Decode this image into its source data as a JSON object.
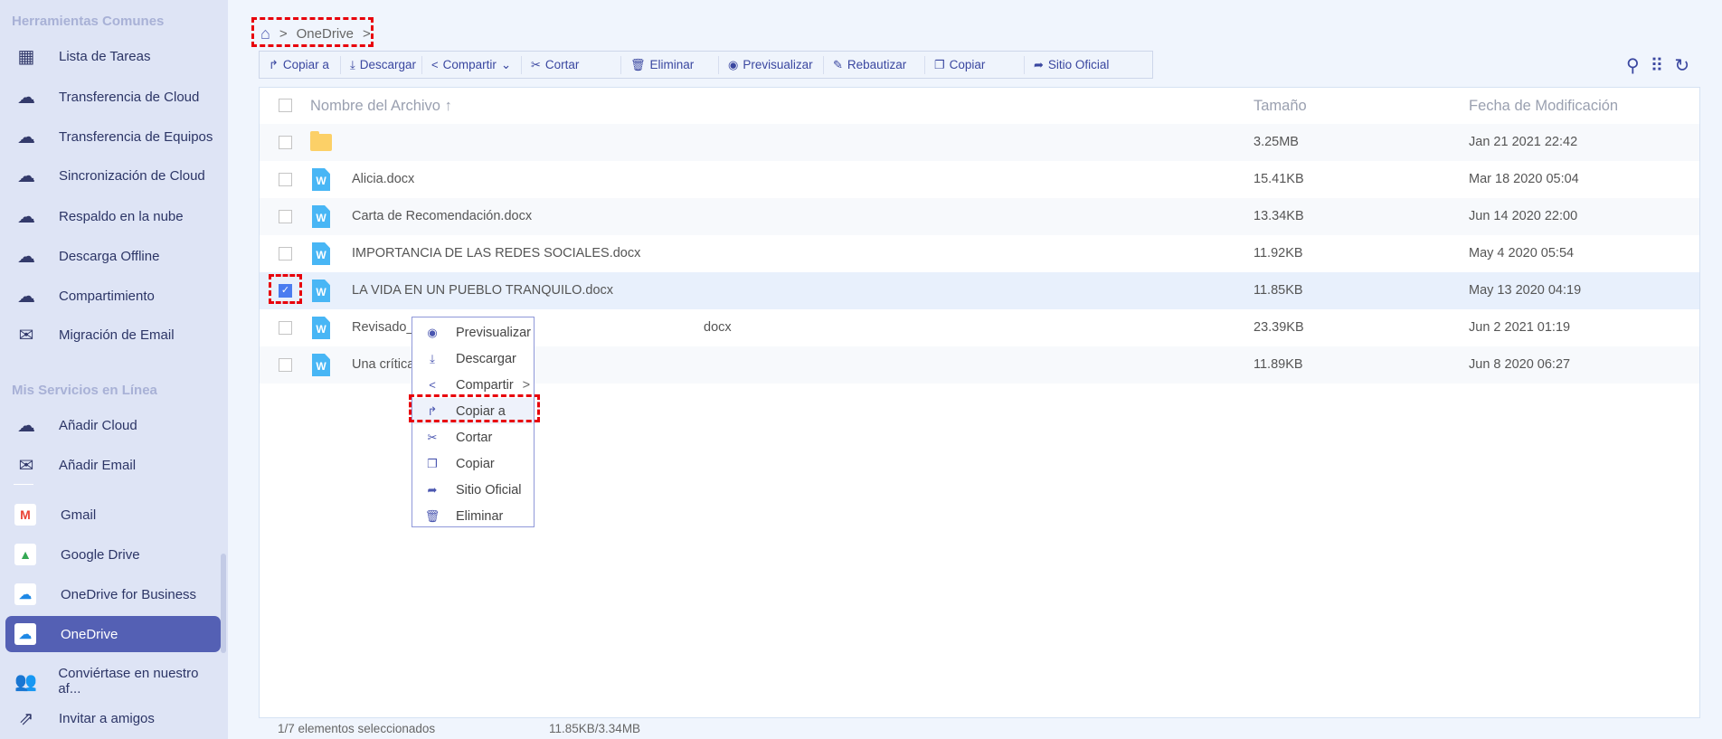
{
  "sidebar": {
    "section1": "Herramientas Comunes",
    "tools": [
      {
        "label": "Lista de Tareas",
        "icon": "grid-icon",
        "glyph": "▦"
      },
      {
        "label": "Transferencia de Cloud",
        "icon": "cloud-transfer-icon",
        "glyph": "☁"
      },
      {
        "label": "Transferencia de Equipos",
        "icon": "team-transfer-icon",
        "glyph": "☁"
      },
      {
        "label": "Sincronización de Cloud",
        "icon": "cloud-sync-icon",
        "glyph": "☁"
      },
      {
        "label": "Respaldo en la nube",
        "icon": "cloud-backup-icon",
        "glyph": "☁"
      },
      {
        "label": "Descarga Offline",
        "icon": "cloud-download-icon",
        "glyph": "☁"
      },
      {
        "label": "Compartimiento",
        "icon": "share-cloud-icon",
        "glyph": "☁"
      },
      {
        "label": "Migración de Email",
        "icon": "email-migration-icon",
        "glyph": "✉"
      }
    ],
    "section2": "Mis Servicios en Línea",
    "services": [
      {
        "label": "Añadir Cloud",
        "icon": "add-cloud-icon",
        "glyph": "☁"
      },
      {
        "label": "Añadir Email",
        "icon": "add-email-icon",
        "glyph": "✉"
      }
    ],
    "accounts": [
      {
        "label": "Gmail",
        "icon": "gmail-icon",
        "glyph": "M",
        "color": "#ea4335"
      },
      {
        "label": "Google Drive",
        "icon": "google-drive-icon",
        "glyph": "▲",
        "color": "#34a853"
      },
      {
        "label": "OneDrive for Business",
        "icon": "onedrive-business-icon",
        "glyph": "☁",
        "color": "#1e88e5"
      },
      {
        "label": "OneDrive",
        "icon": "onedrive-icon",
        "glyph": "☁",
        "color": "#1e88e5",
        "active": true
      }
    ],
    "bottom": [
      {
        "label": "Conviértase en nuestro af...",
        "icon": "affiliate-users-icon",
        "glyph": "👥"
      },
      {
        "label": "Invitar a amigos",
        "icon": "invite-share-icon",
        "glyph": "⇗"
      }
    ]
  },
  "breadcrumb": {
    "current": "OneDrive",
    "sep": ">"
  },
  "toolbar": [
    {
      "label": "Copiar a",
      "icon": "copy-to-icon",
      "glyph": "↱",
      "w": 90
    },
    {
      "label": "Descargar",
      "icon": "download-icon",
      "glyph": "⤓",
      "w": 90
    },
    {
      "label": "Compartir",
      "icon": "share-icon",
      "glyph": "<",
      "w": 110,
      "caret": "⌄"
    },
    {
      "label": "Cortar",
      "icon": "scissors-icon",
      "glyph": "✂",
      "w": 110
    },
    {
      "label": "Eliminar",
      "icon": "trash-icon",
      "glyph": "🗑",
      "w": 108
    },
    {
      "label": "Previsualizar",
      "icon": "eye-icon",
      "glyph": "◉",
      "w": 116
    },
    {
      "label": "Rebautizar",
      "icon": "pencil-icon",
      "glyph": "✎",
      "w": 112
    },
    {
      "label": "Copiar",
      "icon": "copy-icon",
      "glyph": "❐",
      "w": 110
    },
    {
      "label": "Sitio Oficial",
      "icon": "external-share-icon",
      "glyph": "➦",
      "w": 110
    }
  ],
  "table": {
    "headers": {
      "name": "Nombre del Archivo",
      "sort": "↑",
      "size": "Tamaño",
      "date": "Fecha de Modificación"
    },
    "rows": [
      {
        "name": "",
        "type": "folder",
        "size": "3.25MB",
        "date": "Jan 21 2021 22:42"
      },
      {
        "name": "Alicia.docx",
        "type": "docx",
        "size": "15.41KB",
        "date": "Mar 18 2020 05:04"
      },
      {
        "name": "Carta de Recomendación.docx",
        "type": "docx",
        "size": "13.34KB",
        "date": "Jun 14 2020 22:00"
      },
      {
        "name": "IMPORTANCIA DE LAS REDES SOCIALES.docx",
        "type": "docx",
        "size": "11.92KB",
        "date": "May 4 2020 05:54"
      },
      {
        "name": "LA VIDA EN UN PUEBLO TRANQUILO.docx",
        "type": "docx",
        "size": "11.85KB",
        "date": "May 13 2020 04:19",
        "selected": true
      },
      {
        "name": "Revisado_",
        "name_tail": "docx",
        "type": "docx",
        "size": "23.39KB",
        "date": "Jun 2 2021 01:19"
      },
      {
        "name": "Una crítica",
        "type": "docx",
        "size": "11.89KB",
        "date": "Jun 8 2020 06:27"
      }
    ]
  },
  "context_menu": [
    {
      "label": "Previsualizar",
      "icon": "eye-icon",
      "glyph": "◉"
    },
    {
      "label": "Descargar",
      "icon": "download-icon",
      "glyph": "⤓"
    },
    {
      "label": "Compartir",
      "icon": "share-icon",
      "glyph": "<",
      "submenu": ">"
    },
    {
      "label": "Copiar a",
      "icon": "copy-to-icon",
      "glyph": "↱",
      "highlighted": true
    },
    {
      "label": "Cortar",
      "icon": "scissors-icon",
      "glyph": "✂"
    },
    {
      "label": "Copiar",
      "icon": "copy-icon",
      "glyph": "❐"
    },
    {
      "label": "Sitio Oficial",
      "icon": "external-share-icon",
      "glyph": "➦"
    },
    {
      "label": "Eliminar",
      "icon": "trash-icon",
      "glyph": "🗑"
    }
  ],
  "footer": {
    "selection": "1/7 elementos seleccionados",
    "size": "11.85KB/3.34MB"
  },
  "colors": {
    "accent": "#5460b4",
    "highlight": "#e8000b",
    "sidebar": "#dee4f5"
  }
}
